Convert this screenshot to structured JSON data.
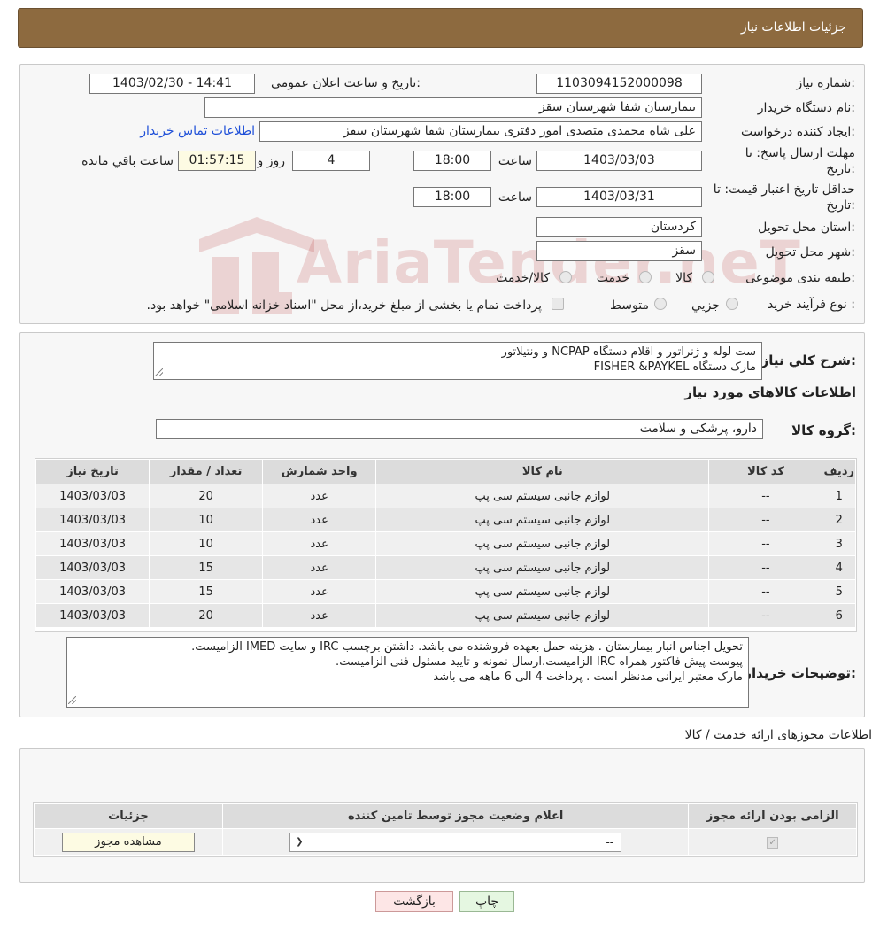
{
  "header": {
    "title": "جزئیات اطلاعات نیاز"
  },
  "watermark": {
    "text": "AriaTender.neT"
  },
  "fields": {
    "need_number_label": "شماره نیاز:",
    "need_number": "1103094152000098",
    "announce_label": "تاریخ و ساعت اعلان عمومی:",
    "announce_value": "1403/02/30 - 14:41",
    "buyer_org_label": "نام دستگاه خریدار:",
    "buyer_org": "بیمارستان شفا شهرستان سقز",
    "requester_label": "ایجاد کننده درخواست:",
    "requester": "علی شاه محمدی متصدی امور دفتری بیمارستان شفا شهرستان سقز",
    "contact_link": "اطلاعات تماس خریدار",
    "deadline_label_1": "مهلت ارسال پاسخ: تا",
    "deadline_label_2": "تاریخ:",
    "deadline_date": "1403/03/03",
    "time_word": "ساعت",
    "deadline_time": "18:00",
    "days_value": "4",
    "days_word": "روز و",
    "remaining_time": "01:57:15",
    "remaining_word": "ساعت باقي مانده",
    "validity_label_1": "حداقل تاریخ اعتبار قیمت: تا",
    "validity_label_2": "تاریخ:",
    "validity_date": "1403/03/31",
    "validity_time": "18:00",
    "province_label": "استان محل تحویل:",
    "province": "کردستان",
    "city_label": "شهر محل تحویل:",
    "city": "سقز",
    "category_label": "طبقه بندی موضوعی:",
    "category_options": [
      "کالا",
      "خدمت",
      "کالا/خدمت"
    ],
    "process_label": "نوع فرآیند خرید :",
    "process_options": [
      "جزیي",
      "متوسط"
    ],
    "process_note": "پرداخت تمام یا بخشی از مبلغ خرید،از محل \"اسناد خزانه اسلامی\" خواهد بود."
  },
  "summary": {
    "label": "شرح كلي نياز:",
    "text": "ست لوله  و ژنراتور و اقلام دستگاه NCPAP و ونتیلاتور\nمارک دستگاه FISHER &PAYKEL"
  },
  "goods": {
    "section_title": "اطلاعات کالاهای مورد نیاز",
    "group_label": "گروه کالا:",
    "group_value": "دارو، پزشکی و سلامت",
    "columns": [
      "ردیف",
      "کد کالا",
      "نام کالا",
      "واحد شمارش",
      "تعداد / مقدار",
      "تاریخ نیاز"
    ],
    "rows": [
      [
        "1",
        "--",
        "لوازم جانبی سیستم سی پپ",
        "عدد",
        "20",
        "1403/03/03"
      ],
      [
        "2",
        "--",
        "لوازم جانبی سیستم سی پپ",
        "عدد",
        "10",
        "1403/03/03"
      ],
      [
        "3",
        "--",
        "لوازم جانبی سیستم سی پپ",
        "عدد",
        "10",
        "1403/03/03"
      ],
      [
        "4",
        "--",
        "لوازم جانبی سیستم سی پپ",
        "عدد",
        "15",
        "1403/03/03"
      ],
      [
        "5",
        "--",
        "لوازم جانبی سیستم سی پپ",
        "عدد",
        "15",
        "1403/03/03"
      ],
      [
        "6",
        "--",
        "لوازم جانبی سیستم سی پپ",
        "عدد",
        "20",
        "1403/03/03"
      ]
    ]
  },
  "buyer_notes": {
    "label": "توضیحات خریدار:",
    "text": "تحویل اجناس  انبار بیمارستان . هزینه حمل بعهده فروشنده می باشد.  داشتن برچسب IRC  و سایت  IMED  الزامیست.\nپیوست پیش فاکتور همراه IRC  الزامیست.ارسال نمونه و تایید مسئول فنی الزامیست.\nمارک معتبر ایرانی مدنظر است . پرداخت 4 الی 6 ماهه می باشد"
  },
  "permits": {
    "section_title": "اطلاعات مجوزهای ارائه خدمت / کالا",
    "columns": [
      "الزامی بودن ارائه مجوز",
      "اعلام وضعیت مجوز توسط تامین کننده",
      "جزئیات"
    ],
    "select_value": "--",
    "view_button": "مشاهده مجوز"
  },
  "actions": {
    "print": "چاپ",
    "back": "بازگشت"
  }
}
